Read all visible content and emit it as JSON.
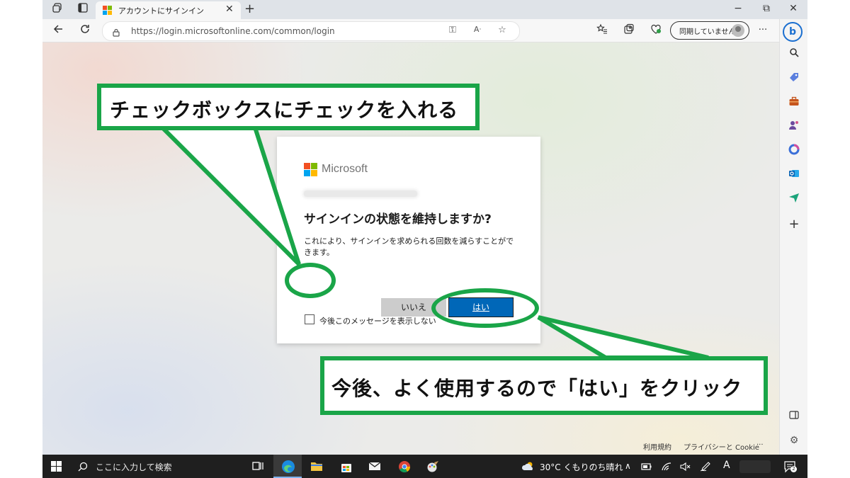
{
  "browser": {
    "tab_title": "アカウントにサインイン",
    "url": "https://login.microsoftonline.com/common/login",
    "sync_label": "同期していません",
    "icons": {
      "tab_actions": "tab-actions-icon",
      "tab_list": "vertical-tabs-icon",
      "new_tab": "plus-icon",
      "back": "back-arrow-icon",
      "refresh": "refresh-icon",
      "lock": "lock-icon",
      "more": "more-icon"
    },
    "new_tab_glyph": "+",
    "more_glyph": "···",
    "window_controls": {
      "minimize": "−",
      "restore": "⧉",
      "close": "✕"
    }
  },
  "sidebar": {
    "items": [
      "search-icon",
      "tag-icon",
      "briefcase-icon",
      "people-icon",
      "office-icon",
      "outlook-icon",
      "send-icon",
      "plus-icon"
    ],
    "bing_glyph": "b",
    "plus_glyph": "+"
  },
  "dialog": {
    "brand": "Microsoft",
    "title": "サインインの状態を維持しますか?",
    "description": "これにより、サインインを求められる回数を減らすことができます。",
    "checkbox_label": "今後このメッセージを表示しない",
    "checkbox_checked": false,
    "no_button": "いいえ",
    "yes_button": "はい",
    "brand_colors": [
      "#f25022",
      "#7fba00",
      "#00a4ef",
      "#ffb900"
    ]
  },
  "footer": {
    "terms": "利用規約",
    "privacy": "プライバシーと Cookie",
    "more": "···"
  },
  "callouts": {
    "top": "チェックボックスにチェックを入れる",
    "bottom": "今後、よく使用するので「はい」をクリック",
    "color": "#1aa548"
  },
  "taskbar": {
    "search_placeholder": "ここに入力して検索",
    "weather": "30°C くもりのち晴れ",
    "ime": "A",
    "notification_count": "2",
    "apps": [
      "task-view-icon",
      "edge-icon",
      "file-explorer-icon",
      "store-icon",
      "mail-icon",
      "chrome-icon",
      "paint-icon"
    ]
  }
}
